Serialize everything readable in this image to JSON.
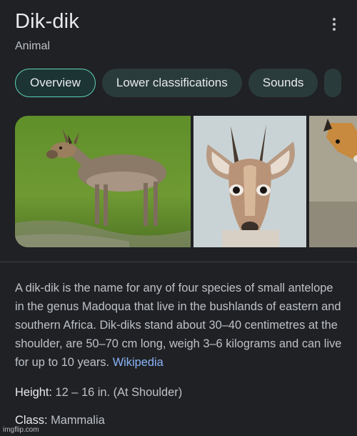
{
  "header": {
    "title": "Dik-dik",
    "subtitle": "Animal"
  },
  "chips": [
    {
      "label": "Overview",
      "active": true
    },
    {
      "label": "Lower classifications",
      "active": false
    },
    {
      "label": "Sounds",
      "active": false
    }
  ],
  "gallery": {
    "images": [
      "dik-dik-standing-photo",
      "dik-dik-face-closeup-photo",
      "dik-dik-partial-photo"
    ]
  },
  "description": {
    "text": "A dik-dik is the name for any of four species of small antelope in the genus Madoqua that live in the bushlands of eastern and southern Africa. Dik-diks stand about 30–40 centimetres at the shoulder, are 50–70 cm long, weigh 3–6 kilograms and can live for up to 10 years.",
    "source_link": "Wikipedia"
  },
  "facts": [
    {
      "label": "Height:",
      "value": "12 – 16 in. (At Shoulder)"
    },
    {
      "label": "Class:",
      "value": "Mammalia"
    }
  ],
  "watermark": "imgflip.com",
  "colors": {
    "background": "#202124",
    "chip_bg": "#2a3b3b",
    "chip_active_border": "#5fd0b8",
    "link": "#8ab4f8"
  }
}
